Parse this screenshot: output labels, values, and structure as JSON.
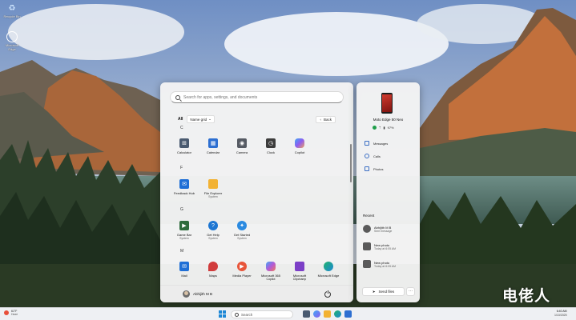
{
  "desktop": {
    "icons": [
      {
        "label": "Recycle Bin",
        "icon": "recycle-bin-icon"
      },
      {
        "label": "Microsoft Edge",
        "icon": "edge-icon"
      }
    ]
  },
  "start_menu": {
    "search_placeholder": "Search for apps, settings, and documents",
    "all_label": "All",
    "view_label": "Name grid",
    "back_label": "Back",
    "sections": [
      {
        "letter": "C",
        "apps": [
          {
            "name": "Calculator",
            "sub": "",
            "icon": "calculator-icon",
            "color": "#4a5a70"
          },
          {
            "name": "Calendar",
            "sub": "",
            "icon": "calendar-icon",
            "color": "#2d6fd1"
          },
          {
            "name": "Camera",
            "sub": "",
            "icon": "camera-icon",
            "color": "#555a63"
          },
          {
            "name": "Clock",
            "sub": "",
            "icon": "clock-icon",
            "color": "#3c3c3c"
          },
          {
            "name": "Copilot",
            "sub": "",
            "icon": "copilot-icon",
            "color": "#7b5cf0"
          }
        ]
      },
      {
        "letter": "F",
        "apps": [
          {
            "name": "Feedback Hub",
            "sub": "",
            "icon": "feedback-hub-icon",
            "color": "#1f6fd6"
          },
          {
            "name": "File Explorer",
            "sub": "System",
            "icon": "folder-icon",
            "color": "#f2b233"
          }
        ]
      },
      {
        "letter": "G",
        "apps": [
          {
            "name": "Game Bar",
            "sub": "System",
            "icon": "game-bar-icon",
            "color": "#2e6b3b"
          },
          {
            "name": "Get Help",
            "sub": "System",
            "icon": "get-help-icon",
            "color": "#1d76d2"
          },
          {
            "name": "Get Started",
            "sub": "System",
            "icon": "get-started-icon",
            "color": "#2a8ae0"
          }
        ]
      },
      {
        "letter": "M",
        "apps": [
          {
            "name": "Mail",
            "sub": "",
            "icon": "mail-icon",
            "color": "#1f6fd6"
          },
          {
            "name": "Maps",
            "sub": "",
            "icon": "maps-icon",
            "color": "#d13c3c"
          },
          {
            "name": "Media Player",
            "sub": "",
            "icon": "media-player-icon",
            "color": "#e8553a"
          },
          {
            "name": "Microsoft 365",
            "sub": "Copilot",
            "icon": "m365-icon",
            "color": "#b25ad8"
          },
          {
            "name": "Microsoft",
            "sub": "Clipchamp",
            "icon": "clipchamp-icon",
            "color": "#7c3fc7"
          },
          {
            "name": "Microsoft Edge",
            "sub": "",
            "icon": "edge-icon",
            "color": "#1e88d6"
          }
        ]
      }
    ],
    "user_name": "Abhijith M B"
  },
  "phone_panel": {
    "device_name": "Moto Edge 50 Neo",
    "battery": "97%",
    "items": [
      {
        "label": "Messages",
        "icon": "messages-icon"
      },
      {
        "label": "Calls",
        "icon": "calls-icon"
      },
      {
        "label": "Photos",
        "icon": "photos-icon"
      }
    ],
    "recent_label": "Recent",
    "recent": [
      {
        "title": "Abhijith M B",
        "sub": "Sent message"
      },
      {
        "title": "New photo",
        "sub": "Today at 6:05 AM"
      },
      {
        "title": "New photo",
        "sub": "Today at 6:05 AM"
      }
    ],
    "send_files_label": "Send files",
    "more_label": "···"
  },
  "taskbar": {
    "temp": "61°F",
    "weather": "Haze",
    "search_label": "Search",
    "time": "6:40 AM",
    "date": "1/10/2025"
  },
  "watermark": "电佬人"
}
